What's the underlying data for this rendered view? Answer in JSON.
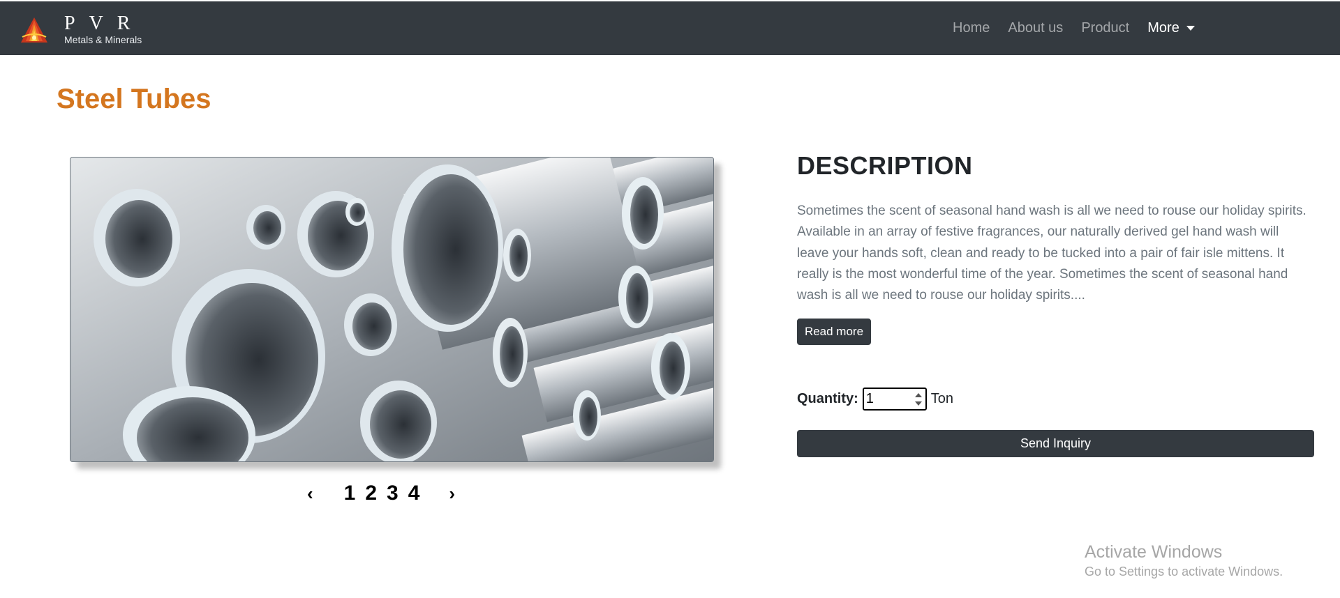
{
  "brand": {
    "name": "PVR",
    "tagline": "Metals & Minerals",
    "logo_icon": "flame-logo-icon"
  },
  "nav": {
    "items": [
      {
        "label": "Home"
      },
      {
        "label": "About us"
      },
      {
        "label": "Product"
      }
    ],
    "more_label": "More",
    "more_icon": "chevron-down-icon"
  },
  "product": {
    "title": "Steel Tubes",
    "image_icon": "steel-tubes-image",
    "pager": {
      "prev": "‹",
      "pages": [
        "1",
        "2",
        "3",
        "4"
      ],
      "next": "›"
    }
  },
  "description": {
    "heading": "DESCRIPTION",
    "text": "Sometimes the scent of seasonal hand wash is all we need to rouse our holiday spirits. Available in an array of festive fragrances, our naturally derived gel hand wash will leave your hands soft, clean and ready to be tucked into a pair of fair isle mittens. It really is the most wonderful time of the year. Sometimes the scent of seasonal hand wash is all we need to rouse our holiday spirits....",
    "read_more_label": "Read more"
  },
  "quantity": {
    "label": "Quantity:",
    "value": "1",
    "unit": "Ton"
  },
  "inquiry": {
    "button_label": "Send Inquiry"
  },
  "watermark": {
    "title": "Activate Windows",
    "subtitle": "Go to Settings to activate Windows."
  },
  "colors": {
    "navbar": "#343a40",
    "title_accent": "#d4761f",
    "button": "#343a40",
    "muted_text": "#6c757d"
  }
}
